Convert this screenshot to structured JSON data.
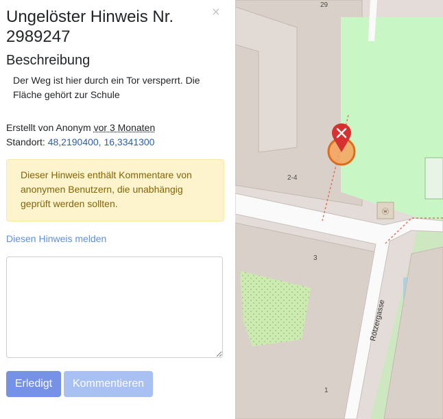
{
  "note": {
    "title": "Ungelöster Hinweis Nr. 2989247",
    "close_symbol": "×",
    "section_title": "Beschreibung",
    "description": "Der Weg ist hier durch ein Tor versperrt. Die Fläche gehört zur Schule",
    "created_prefix": "Erstellt von Anonym",
    "created_ago": "vor 3 Monaten",
    "location_prefix": "Standort:",
    "location_link": "48,2190400, 16,3341300",
    "warning": "Dieser Hinweis enthält Kommentare von anonymen Benutzern, die unabhängig geprüft werden sollten.",
    "report_link": "Diesen Hinweis melden",
    "comment_value": "",
    "resolve_button": "Erledigt",
    "comment_button": "Kommentieren"
  },
  "map": {
    "labels": {
      "house_29": "29",
      "house_2_4": "2-4",
      "house_3": "3",
      "house_1": "1",
      "street": "Rötzergasse"
    },
    "marker_color": "#d63031",
    "park_color": "#c8f7c5"
  }
}
